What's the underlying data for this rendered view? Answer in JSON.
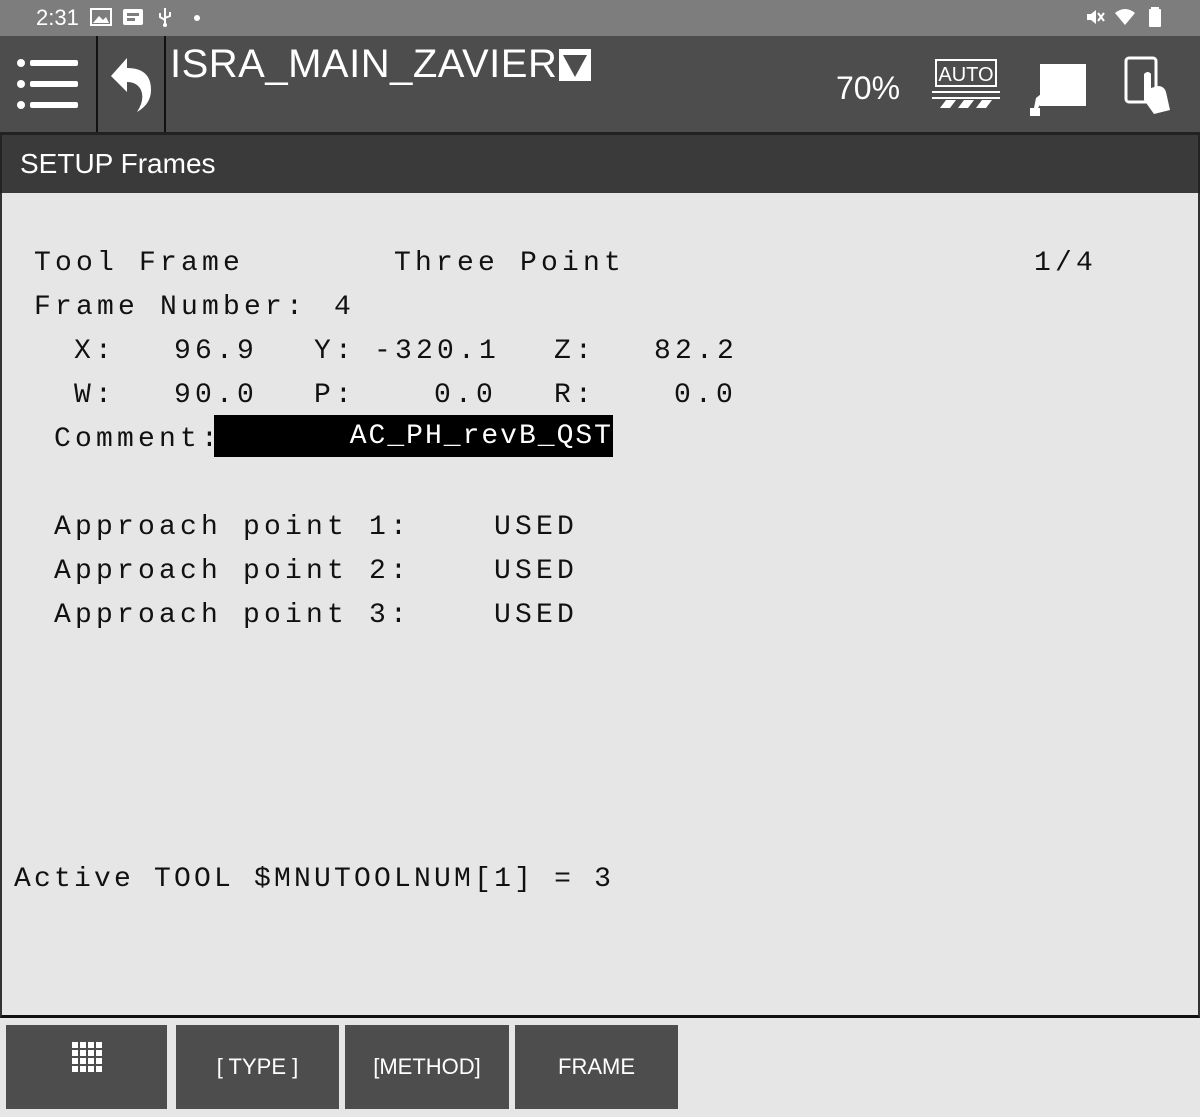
{
  "status_bar": {
    "time": "2:31",
    "left_icons": [
      "image-icon",
      "badge-icon",
      "usb-icon",
      "dot-icon"
    ],
    "right_icons": [
      "mute-icon",
      "wifi-icon",
      "battery-icon"
    ]
  },
  "toolbar": {
    "program_name": "ISRA_MAIN_ZAVIER",
    "override": "70%",
    "mode_label": "AUTO"
  },
  "title": "SETUP Frames",
  "frame": {
    "type_label": "Tool Frame",
    "method_label": "Three Point",
    "page": "1/4",
    "number_label": "Frame Number:",
    "number": "4",
    "coords": {
      "x_label": "X:",
      "x": "96.9",
      "y_label": "Y:",
      "y": "-320.1",
      "z_label": "Z:",
      "z": "82.2",
      "w_label": "W:",
      "w": "90.0",
      "p_label": "P:",
      "p": "0.0",
      "r_label": "R:",
      "r": "0.0"
    },
    "comment_label": "Comment:",
    "comment": "AC_PH_revB_QST",
    "approach_points": [
      {
        "label": "Approach point 1:",
        "status": "USED"
      },
      {
        "label": "Approach point 2:",
        "status": "USED"
      },
      {
        "label": "Approach point 3:",
        "status": "USED"
      }
    ],
    "active_tool": "Active TOOL $MNUTOOLNUM[1] = 3"
  },
  "function_keys": {
    "type": "[ TYPE ]",
    "method": "[METHOD]",
    "frame": "FRAME"
  },
  "colors": {
    "toolbar": "#4d4d4d",
    "title_bar": "#3a3a3a",
    "content_bg": "#e6e6e6",
    "status_bar": "#7d7d7d"
  }
}
